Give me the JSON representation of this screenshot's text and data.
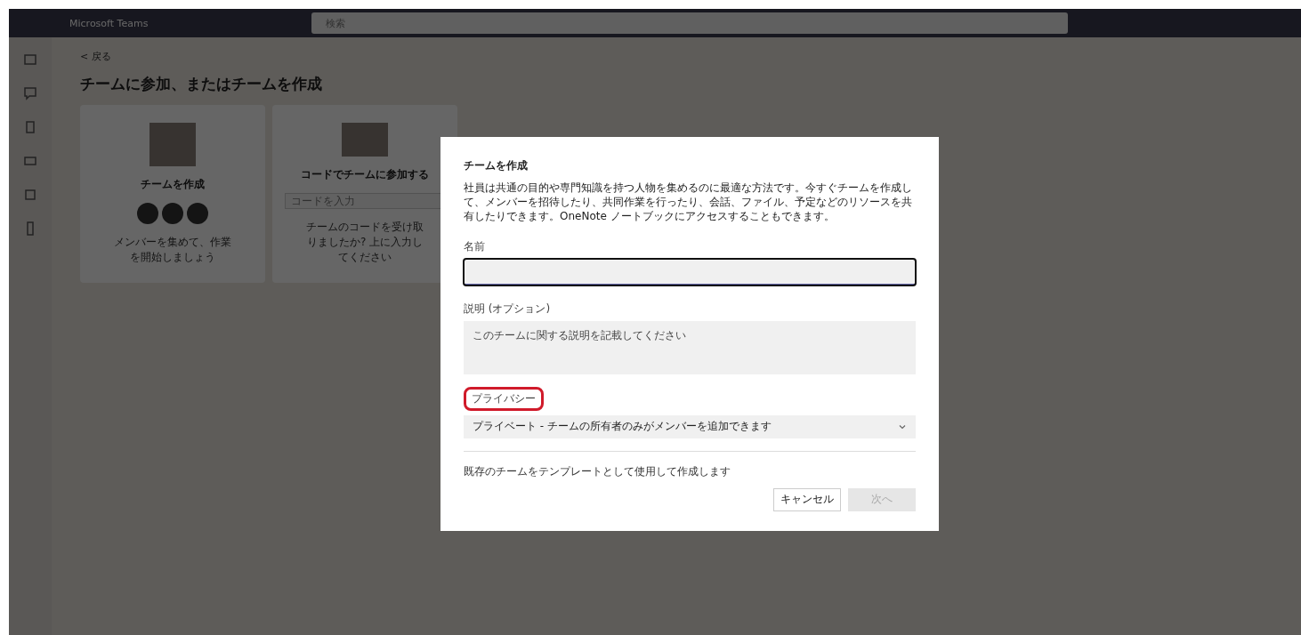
{
  "app": {
    "title": "Microsoft Teams",
    "search_placeholder": "検索"
  },
  "page": {
    "back": "< 戻る",
    "title": "チームに参加、またはチームを作成",
    "cards": [
      {
        "kind": "create",
        "title": "チームを作成",
        "caption": "メンバーを集めて、作業を開始しましょう"
      },
      {
        "kind": "join",
        "title": "コードでチームに参加する",
        "placeholder": "コードを入力",
        "caption": "チームのコードを受け取りましたか? 上に入力してください"
      }
    ]
  },
  "dialog": {
    "title": "チームを作成",
    "description": "社員は共通の目的や専門知識を持つ人物を集めるのに最適な方法です。今すぐチームを作成して、メンバーを招待したり、共同作業を行ったり、会話、ファイル、予定などのリソースを共有したりできます。OneNote ノートブックにアクセスすることもできます。",
    "name_label": "名前",
    "description_label": "説明 (オプション)",
    "description_placeholder": "このチームに関する説明を記載してください",
    "privacy_label": "プライバシー",
    "privacy_highlighted": true,
    "privacy_value": "プライベート - チームの所有者のみがメンバーを追加できます",
    "template_link": "既存のチームをテンプレートとして使用して作成します",
    "cancel": "キャンセル",
    "next": {
      "label": "次へ",
      "disabled": true
    }
  }
}
